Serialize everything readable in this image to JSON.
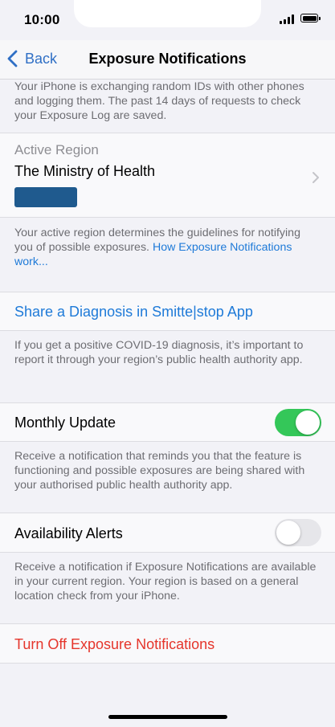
{
  "status_bar": {
    "time": "10:00"
  },
  "nav": {
    "back_label": "Back",
    "title": "Exposure Notifications"
  },
  "intro_text": "Your iPhone is exchanging random IDs with other phones and logging them. The past 14 days of requests to check your Exposure Log are saved.",
  "active_region": {
    "header": "Active Region",
    "value": "The Ministry of Health",
    "badge_color": "#1f5a8e"
  },
  "region_footer": {
    "text": "Your active region determines the guidelines for notifying you of possible exposures.",
    "link": "How Exposure Notifications work..."
  },
  "share_diagnosis": {
    "label": "Share a Diagnosis in Smitte|stop App",
    "footer": "If you get a positive COVID-19 diagnosis, it’s important to report it through your region’s public health authority app."
  },
  "monthly_update": {
    "label": "Monthly Update",
    "enabled": true,
    "footer": "Receive a notification that reminds you that the feature is functioning and possible exposures are being shared with your authorised public health authority app."
  },
  "availability_alerts": {
    "label": "Availability Alerts",
    "enabled": false,
    "footer": "Receive a notification if Exposure Notifications are available in your current region. Your region is based on a general location check from your iPhone."
  },
  "turn_off": {
    "label": "Turn Off Exposure Notifications"
  },
  "colors": {
    "accent": "#1e7ad8",
    "toggle_on": "#34c759",
    "destructive": "#e5352b",
    "background": "#f2f2f7"
  }
}
